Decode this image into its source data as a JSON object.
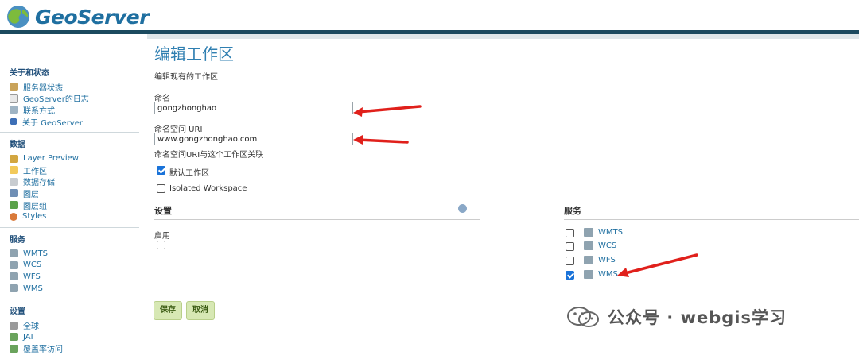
{
  "app": {
    "logo_text": "GeoServer"
  },
  "sidebar": {
    "sections": [
      {
        "title": "关于和状态",
        "items": [
          "服务器状态",
          "GeoServer的日志",
          "联系方式",
          "关于 GeoServer"
        ]
      },
      {
        "title": "数据",
        "items": [
          "Layer Preview",
          "工作区",
          "数据存储",
          "图层",
          "图层组",
          "Styles"
        ]
      },
      {
        "title": "服务",
        "items": [
          "WMTS",
          "WCS",
          "WFS",
          "WMS"
        ]
      },
      {
        "title": "设置",
        "items": [
          "全球",
          "JAI",
          "覆盖率访问"
        ]
      }
    ]
  },
  "page": {
    "title": "编辑工作区",
    "subtitle": "编辑现有的工作区",
    "name_label": "命名",
    "name_value": "gongzhonghao",
    "uri_label": "命名空间 URI",
    "uri_value": "www.gongzhonghao.com",
    "uri_hint": "命名空间URI与这个工作区关联",
    "default_ws_label": "默认工作区",
    "default_ws_checked": true,
    "isolated_label": "Isolated Workspace",
    "isolated_checked": false
  },
  "settings": {
    "title": "设置",
    "enabled_label": "启用",
    "enabled_checked": false
  },
  "services": {
    "title": "服务",
    "items": [
      {
        "label": "WMTS",
        "checked": false
      },
      {
        "label": "WCS",
        "checked": false
      },
      {
        "label": "WFS",
        "checked": false
      },
      {
        "label": "WMS",
        "checked": true
      }
    ]
  },
  "buttons": {
    "save": "保存",
    "cancel": "取消"
  },
  "watermark": {
    "text": "公众号 · webgis学习"
  },
  "colors": {
    "link": "#1f6fa0",
    "title": "#2f7fb1",
    "header_bar": "#1c4a5f",
    "arrow": "#e0201b",
    "check": "#1a73d9"
  }
}
